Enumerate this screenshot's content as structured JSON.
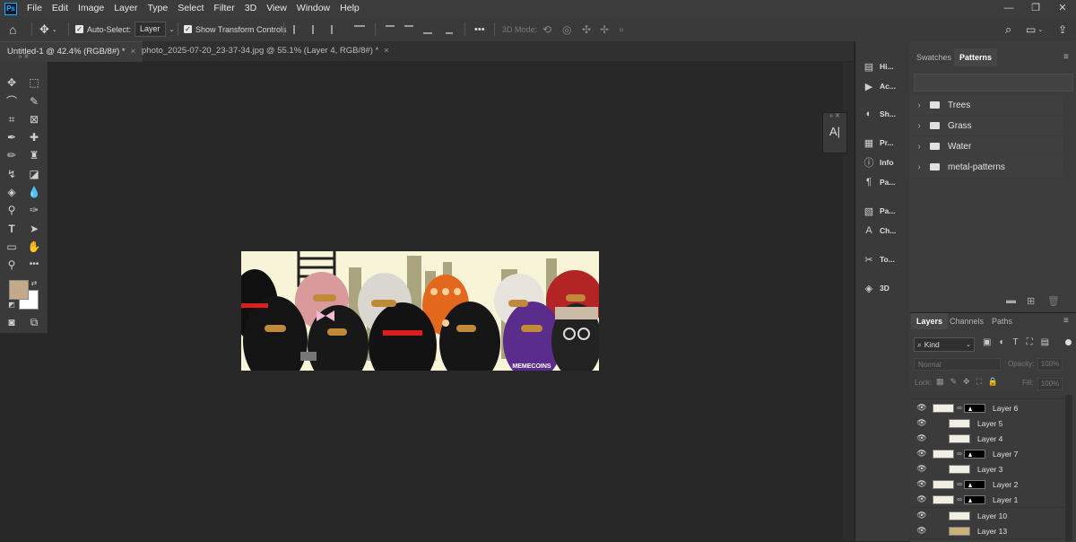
{
  "menu": [
    "File",
    "Edit",
    "Image",
    "Layer",
    "Type",
    "Select",
    "Filter",
    "3D",
    "View",
    "Window",
    "Help"
  ],
  "app_logo": "Ps",
  "options": {
    "auto_select_label": "Auto-Select:",
    "auto_select_value": "Layer",
    "show_transform_label": "Show Transform Controls",
    "more": "•••",
    "mode_3d_label": "3D Mode:"
  },
  "tabs": [
    {
      "label": "Untitled-1 @ 42.4% (RGB/8#) *",
      "active": true
    },
    {
      "label": "photo_2025-07-20_23-37-34.jpg @ 55.1% (Layer 4, RGB/8#) *",
      "active": false
    }
  ],
  "tab_close": "×",
  "toolbox": {
    "more_tools": "•••"
  },
  "canvas": {
    "banner_text": "MEMECOINS"
  },
  "mini_panel": {
    "glyph": "A|"
  },
  "dock": [
    {
      "icon": "history-icon",
      "glyph": "▤",
      "label": "Hi..."
    },
    {
      "icon": "actions-icon",
      "glyph": "▶",
      "label": "Ac..."
    },
    {
      "icon": "shapes-icon",
      "glyph": "◐",
      "label": "Sh..."
    },
    {
      "icon": "properties-icon",
      "glyph": "▦",
      "label": "Pr..."
    },
    {
      "icon": "info-icon",
      "glyph": "ⓘ",
      "label": "Info"
    },
    {
      "icon": "paragraph-icon",
      "glyph": "¶",
      "label": "Pa..."
    },
    {
      "icon": "paragraph-styles-icon",
      "glyph": "▧",
      "label": "Pa..."
    },
    {
      "icon": "character-styles-icon",
      "glyph": "A",
      "label": "Ch..."
    },
    {
      "icon": "tool-presets-icon",
      "glyph": "✂",
      "label": "To..."
    },
    {
      "icon": "3d-icon",
      "glyph": "◈",
      "label": "3D"
    }
  ],
  "patterns_panel": {
    "tabs": [
      "Swatches",
      "Patterns"
    ],
    "active_tab": "Patterns",
    "folders": [
      "Trees",
      "Grass",
      "Water",
      "metal-patterns"
    ]
  },
  "layers_panel": {
    "tabs": [
      "Layers",
      "Channels",
      "Paths"
    ],
    "active_tab": "Layers",
    "filter_label": "Kind",
    "blend_mode": "Normal",
    "opacity_label": "Opacity:",
    "opacity_value": "100%",
    "lock_label": "Lock:",
    "fill_label": "Fill:",
    "fill_value": "100%",
    "layers": [
      {
        "name": "Layer 6",
        "mask": true
      },
      {
        "name": "Layer 5",
        "mask": false
      },
      {
        "name": "Layer 4",
        "mask": false
      },
      {
        "name": "Layer 7",
        "mask": true
      },
      {
        "name": "Layer 3",
        "mask": false
      },
      {
        "name": "Layer 2",
        "mask": true
      },
      {
        "name": "Layer 1",
        "mask": true
      },
      {
        "name": "Layer 10",
        "mask": false
      },
      {
        "name": "Layer 13",
        "mask": false
      }
    ]
  },
  "colors": {
    "foreground": "#c4a98b",
    "background": "#ffffff",
    "accent": "#31a8ff"
  }
}
